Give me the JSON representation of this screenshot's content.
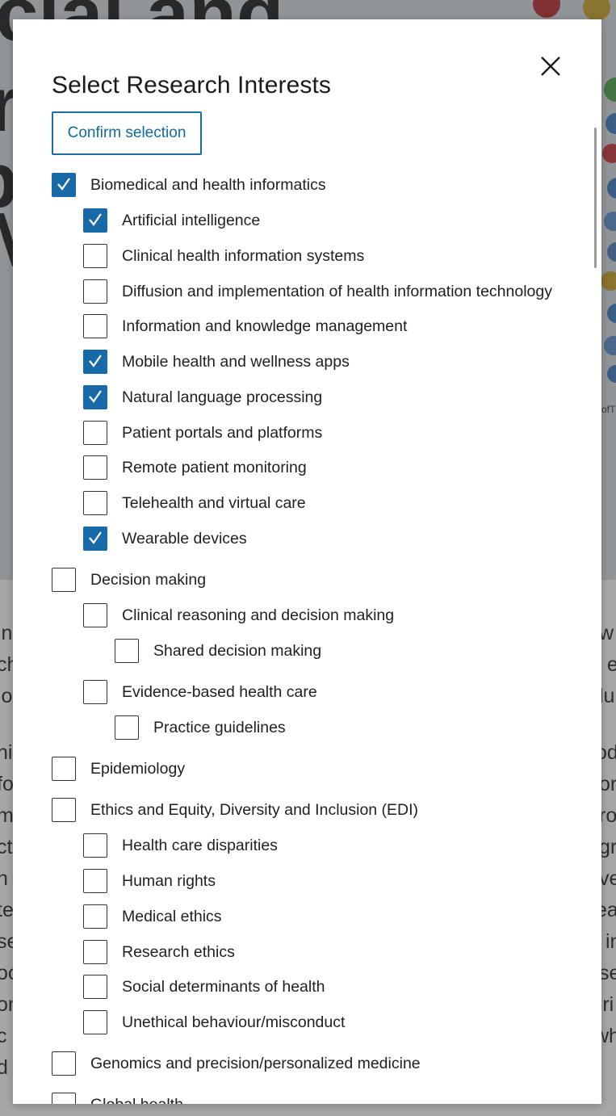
{
  "background": {
    "hero_lines": [
      "cial and",
      "r",
      "p",
      "M"
    ],
    "left_fragments": [
      "in",
      "ch",
      "lo",
      "nis",
      "fo",
      "m",
      "ct",
      "n",
      "te",
      "se",
      "oc",
      "on",
      "c",
      "d"
    ],
    "right_fragments": [
      "w",
      ", e",
      "lu",
      "od",
      "or",
      "ro",
      "gr",
      "ve",
      "ea",
      "in",
      "se",
      "-ri",
      "wh"
    ],
    "hero_caption": "ofT"
  },
  "modal": {
    "title": "Select Research Interests",
    "close_icon": "close-icon",
    "confirm_label": "Confirm selection",
    "items": [
      {
        "label": "Biomedical and health informatics",
        "level": 0,
        "checked": true
      },
      {
        "label": "Artificial intelligence",
        "level": 1,
        "checked": true
      },
      {
        "label": "Clinical health information systems",
        "level": 1,
        "checked": false
      },
      {
        "label": "Diffusion and implementation of health information technology",
        "level": 1,
        "checked": false
      },
      {
        "label": "Information and knowledge management",
        "level": 1,
        "checked": false
      },
      {
        "label": "Mobile health and wellness apps",
        "level": 1,
        "checked": true
      },
      {
        "label": "Natural language processing",
        "level": 1,
        "checked": true
      },
      {
        "label": "Patient portals and platforms",
        "level": 1,
        "checked": false
      },
      {
        "label": "Remote patient monitoring",
        "level": 1,
        "checked": false
      },
      {
        "label": "Telehealth and virtual care",
        "level": 1,
        "checked": false
      },
      {
        "label": "Wearable devices",
        "level": 1,
        "checked": true
      },
      {
        "label": "Decision making",
        "level": 0,
        "checked": false
      },
      {
        "label": "Clinical reasoning and decision making",
        "level": 1,
        "checked": false
      },
      {
        "label": "Shared decision making",
        "level": 2,
        "checked": false
      },
      {
        "label": "Evidence-based health care",
        "level": 1,
        "checked": false
      },
      {
        "label": "Practice guidelines",
        "level": 2,
        "checked": false
      },
      {
        "label": "Epidemiology",
        "level": 0,
        "checked": false
      },
      {
        "label": "Ethics and Equity, Diversity and Inclusion (EDI)",
        "level": 0,
        "checked": false
      },
      {
        "label": "Health care disparities",
        "level": 1,
        "checked": false
      },
      {
        "label": "Human rights",
        "level": 1,
        "checked": false
      },
      {
        "label": "Medical ethics",
        "level": 1,
        "checked": false
      },
      {
        "label": "Research ethics",
        "level": 1,
        "checked": false
      },
      {
        "label": "Social determinants of health",
        "level": 1,
        "checked": false
      },
      {
        "label": "Unethical behaviour/misconduct",
        "level": 1,
        "checked": false
      },
      {
        "label": "Genomics and precision/personalized medicine",
        "level": 0,
        "checked": false
      },
      {
        "label": "Global health",
        "level": 0,
        "checked": false
      }
    ]
  },
  "colors": {
    "accent": "#1769a8",
    "confirm_border": "#1a6fa0",
    "check_mark": "#ffffff"
  }
}
